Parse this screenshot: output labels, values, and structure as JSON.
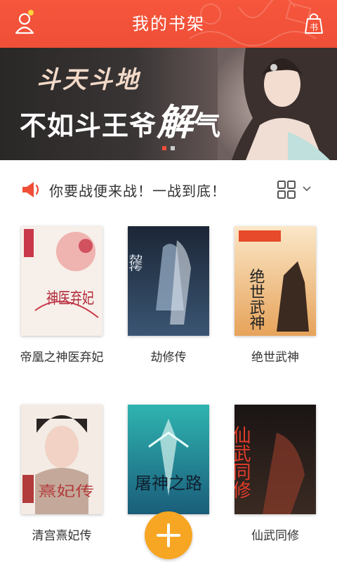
{
  "header": {
    "title": "我的书架",
    "left_icon": "user-icon",
    "right_icon": "bookshelf-bag-icon",
    "shelf_glyph": "书",
    "accent": "#f04e36"
  },
  "banner": {
    "line1": "斗天斗地",
    "line2_prefix": "不如斗王爷",
    "line2_big": "解",
    "line2_suffix": "气",
    "slide_count": 2,
    "active_slide": 0
  },
  "notice": {
    "icon": "speaker-icon",
    "text": "你要战便来战！一战到底！",
    "view_icon": "grid-view-icon",
    "dropdown_icon": "chevron-down-icon"
  },
  "books": [
    {
      "title": "帝凰之神医弃妃",
      "cover_text": "神医弃妃"
    },
    {
      "title": "劫修传",
      "cover_text": "劫修传"
    },
    {
      "title": "绝世武神",
      "cover_text": "绝世武神"
    },
    {
      "title": "清宫熹妃传",
      "cover_text": "熹妃传"
    },
    {
      "title": "屠神之路",
      "cover_text": "屠神之路"
    },
    {
      "title": "仙武同修",
      "cover_text": "仙武同修"
    }
  ],
  "fab": {
    "icon": "plus-icon"
  }
}
